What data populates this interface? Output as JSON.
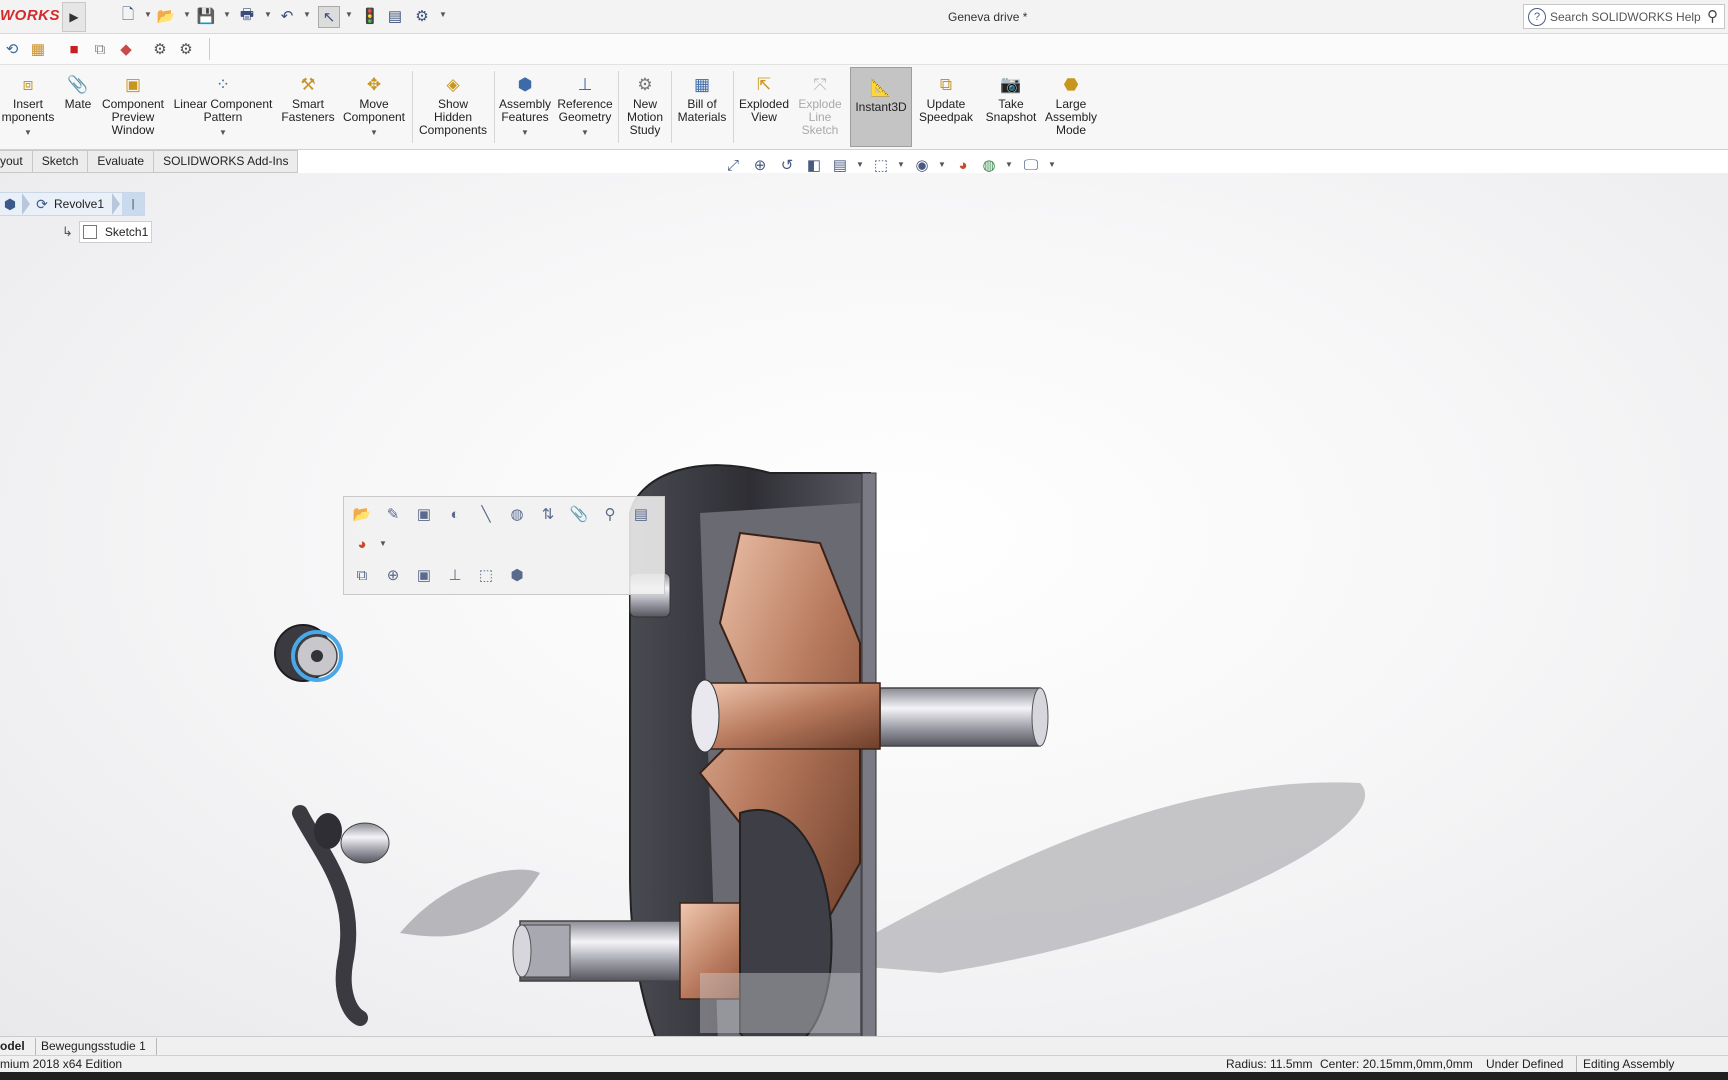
{
  "app": {
    "logo_text": "WORKS",
    "document_title": "Geneva drive *",
    "search_placeholder": "Search SOLIDWORKS Help"
  },
  "command_manager": {
    "buttons": [
      {
        "label1": "Insert",
        "label2": "mponents",
        "label3": "",
        "dropdown": true,
        "icon": "insert-components-icon"
      },
      {
        "label1": "Mate",
        "label2": "",
        "label3": "",
        "dropdown": false,
        "icon": "mate-icon"
      },
      {
        "label1": "Component",
        "label2": "Preview",
        "label3": "Window",
        "dropdown": false,
        "icon": "component-preview-icon"
      },
      {
        "label1": "Linear Component",
        "label2": "Pattern",
        "label3": "",
        "dropdown": true,
        "icon": "linear-pattern-icon"
      },
      {
        "label1": "Smart",
        "label2": "Fasteners",
        "label3": "",
        "dropdown": false,
        "icon": "smart-fasteners-icon"
      },
      {
        "label1": "Move",
        "label2": "Component",
        "label3": "",
        "dropdown": true,
        "icon": "move-component-icon"
      },
      {
        "label1": "Show",
        "label2": "Hidden",
        "label3": "Components",
        "dropdown": false,
        "icon": "show-hidden-icon"
      },
      {
        "label1": "Assembly",
        "label2": "Features",
        "label3": "",
        "dropdown": true,
        "icon": "assembly-features-icon"
      },
      {
        "label1": "Reference",
        "label2": "Geometry",
        "label3": "",
        "dropdown": true,
        "icon": "reference-geometry-icon"
      },
      {
        "label1": "New",
        "label2": "Motion",
        "label3": "Study",
        "dropdown": false,
        "icon": "motion-study-icon"
      },
      {
        "label1": "Bill of",
        "label2": "Materials",
        "label3": "",
        "dropdown": false,
        "icon": "bom-icon"
      },
      {
        "label1": "Exploded",
        "label2": "View",
        "label3": "",
        "dropdown": false,
        "icon": "exploded-view-icon"
      },
      {
        "label1": "Explode",
        "label2": "Line",
        "label3": "Sketch",
        "dropdown": false,
        "icon": "explode-line-icon",
        "disabled": true
      },
      {
        "label1": "Instant3D",
        "label2": "",
        "label3": "",
        "dropdown": false,
        "icon": "instant3d-icon",
        "active": true
      },
      {
        "label1": "Update",
        "label2": "Speedpak",
        "label3": "",
        "dropdown": false,
        "icon": "speedpak-icon"
      },
      {
        "label1": "Take",
        "label2": "Snapshot",
        "label3": "",
        "dropdown": false,
        "icon": "snapshot-icon"
      },
      {
        "label1": "Large",
        "label2": "Assembly",
        "label3": "Mode",
        "dropdown": false,
        "icon": "large-assembly-icon"
      }
    ]
  },
  "tabs": [
    "yout",
    "Sketch",
    "Evaluate",
    "SOLIDWORKS Add-Ins"
  ],
  "breadcrumb": {
    "feature": "Revolve1",
    "sketch": "Sketch1"
  },
  "bottom_tabs": [
    "odel",
    "Bewegungsstudie 1"
  ],
  "status": {
    "edition": "mium 2018 x64 Edition",
    "radius": "Radius: 11.5mm",
    "center": "Center: 20.15mm,0mm,0mm",
    "state": "Under Defined",
    "mode": "Editing Assembly"
  }
}
